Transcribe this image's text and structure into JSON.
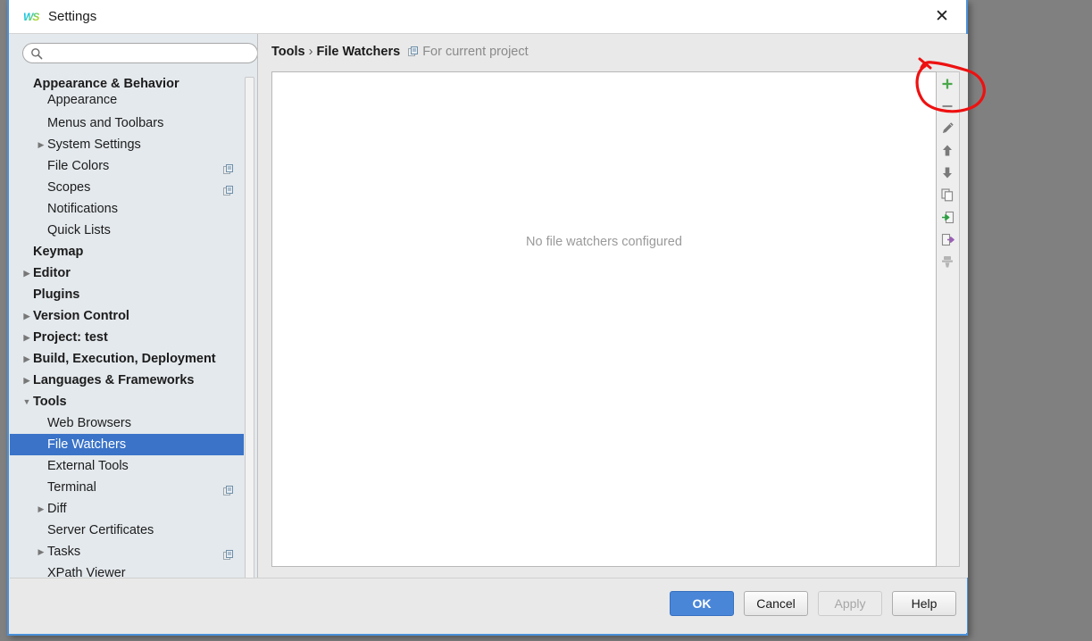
{
  "window": {
    "title": "Settings",
    "logo_text": "WS",
    "close_label": "✕"
  },
  "search": {
    "value": "",
    "placeholder": ""
  },
  "sidebar": {
    "items": [
      {
        "label": "Appearance & Behavior",
        "level": 0,
        "group": true,
        "arrow": "",
        "badge": false,
        "selected": false,
        "partial": false
      },
      {
        "label": "Appearance",
        "level": 1,
        "group": false,
        "arrow": "",
        "badge": false,
        "selected": false,
        "partial": true
      },
      {
        "label": "Menus and Toolbars",
        "level": 1,
        "group": false,
        "arrow": "",
        "badge": false,
        "selected": false,
        "partial": false
      },
      {
        "label": "System Settings",
        "level": 1,
        "group": false,
        "arrow": "▶",
        "badge": false,
        "selected": false,
        "partial": false
      },
      {
        "label": "File Colors",
        "level": 1,
        "group": false,
        "arrow": "",
        "badge": true,
        "selected": false,
        "partial": false
      },
      {
        "label": "Scopes",
        "level": 1,
        "group": false,
        "arrow": "",
        "badge": true,
        "selected": false,
        "partial": false
      },
      {
        "label": "Notifications",
        "level": 1,
        "group": false,
        "arrow": "",
        "badge": false,
        "selected": false,
        "partial": false
      },
      {
        "label": "Quick Lists",
        "level": 1,
        "group": false,
        "arrow": "",
        "badge": false,
        "selected": false,
        "partial": false
      },
      {
        "label": "Keymap",
        "level": 0,
        "group": true,
        "arrow": "",
        "badge": false,
        "selected": false,
        "partial": false
      },
      {
        "label": "Editor",
        "level": 0,
        "group": true,
        "arrow": "▶",
        "badge": false,
        "selected": false,
        "partial": false
      },
      {
        "label": "Plugins",
        "level": 0,
        "group": true,
        "arrow": "",
        "badge": false,
        "selected": false,
        "partial": false
      },
      {
        "label": "Version Control",
        "level": 0,
        "group": true,
        "arrow": "▶",
        "badge": false,
        "selected": false,
        "partial": false
      },
      {
        "label": "Project: test",
        "level": 0,
        "group": true,
        "arrow": "▶",
        "badge": false,
        "selected": false,
        "partial": false
      },
      {
        "label": "Build, Execution, Deployment",
        "level": 0,
        "group": true,
        "arrow": "▶",
        "badge": false,
        "selected": false,
        "partial": false
      },
      {
        "label": "Languages & Frameworks",
        "level": 0,
        "group": true,
        "arrow": "▶",
        "badge": false,
        "selected": false,
        "partial": false
      },
      {
        "label": "Tools",
        "level": 0,
        "group": true,
        "arrow": "▼",
        "badge": false,
        "selected": false,
        "partial": false
      },
      {
        "label": "Web Browsers",
        "level": 1,
        "group": false,
        "arrow": "",
        "badge": false,
        "selected": false,
        "partial": false
      },
      {
        "label": "File Watchers",
        "level": 1,
        "group": false,
        "arrow": "",
        "badge": true,
        "selected": true,
        "partial": false
      },
      {
        "label": "External Tools",
        "level": 1,
        "group": false,
        "arrow": "",
        "badge": false,
        "selected": false,
        "partial": false
      },
      {
        "label": "Terminal",
        "level": 1,
        "group": false,
        "arrow": "",
        "badge": true,
        "selected": false,
        "partial": false
      },
      {
        "label": "Diff",
        "level": 1,
        "group": false,
        "arrow": "▶",
        "badge": false,
        "selected": false,
        "partial": false
      },
      {
        "label": "Server Certificates",
        "level": 1,
        "group": false,
        "arrow": "",
        "badge": false,
        "selected": false,
        "partial": false
      },
      {
        "label": "Tasks",
        "level": 1,
        "group": false,
        "arrow": "▶",
        "badge": true,
        "selected": false,
        "partial": false
      },
      {
        "label": "XPath Viewer",
        "level": 1,
        "group": false,
        "arrow": "",
        "badge": false,
        "selected": false,
        "partial": false
      }
    ],
    "selected_color": "#3a73c8"
  },
  "breadcrumb": {
    "root": "Tools",
    "separator": "›",
    "current": "File Watchers",
    "scope": "For current project"
  },
  "main": {
    "empty_message": "No file watchers configured"
  },
  "toolbar": {
    "buttons": [
      {
        "name": "add-watcher-button",
        "icon": "plus-icon",
        "tooltip": "Add",
        "color": "#4aa84a",
        "disabled": false
      },
      {
        "name": "remove-watcher-button",
        "icon": "minus-icon",
        "tooltip": "Remove",
        "color": "#8a8a8a",
        "disabled": true
      },
      {
        "name": "edit-watcher-button",
        "icon": "pencil-icon",
        "tooltip": "Edit",
        "color": "#7a7a7a",
        "disabled": true
      },
      {
        "name": "move-up-button",
        "icon": "arrow-up-icon",
        "tooltip": "Move Up",
        "color": "#7a7a7a",
        "disabled": true
      },
      {
        "name": "move-down-button",
        "icon": "arrow-down-icon",
        "tooltip": "Move Down",
        "color": "#7a7a7a",
        "disabled": true
      },
      {
        "name": "copy-watcher-button",
        "icon": "copy-icon",
        "tooltip": "Copy",
        "color": "#8a8a8a",
        "disabled": true
      },
      {
        "name": "import-button",
        "icon": "import-arrow-icon",
        "tooltip": "Import",
        "color": "#2e9e42",
        "disabled": false
      },
      {
        "name": "export-button",
        "icon": "export-arrow-icon",
        "tooltip": "Export",
        "color": "#9a5fb5",
        "disabled": false
      },
      {
        "name": "filter-button",
        "icon": "filter-icon",
        "tooltip": "Filter",
        "color": "#b4b4b4",
        "disabled": true
      }
    ]
  },
  "footer": {
    "ok_label": "OK",
    "cancel_label": "Cancel",
    "apply_label": "Apply",
    "help_label": "Help"
  },
  "annotation": {
    "shape": "red-ellipse",
    "color": "#ee1111",
    "targets": "add-watcher-button"
  }
}
